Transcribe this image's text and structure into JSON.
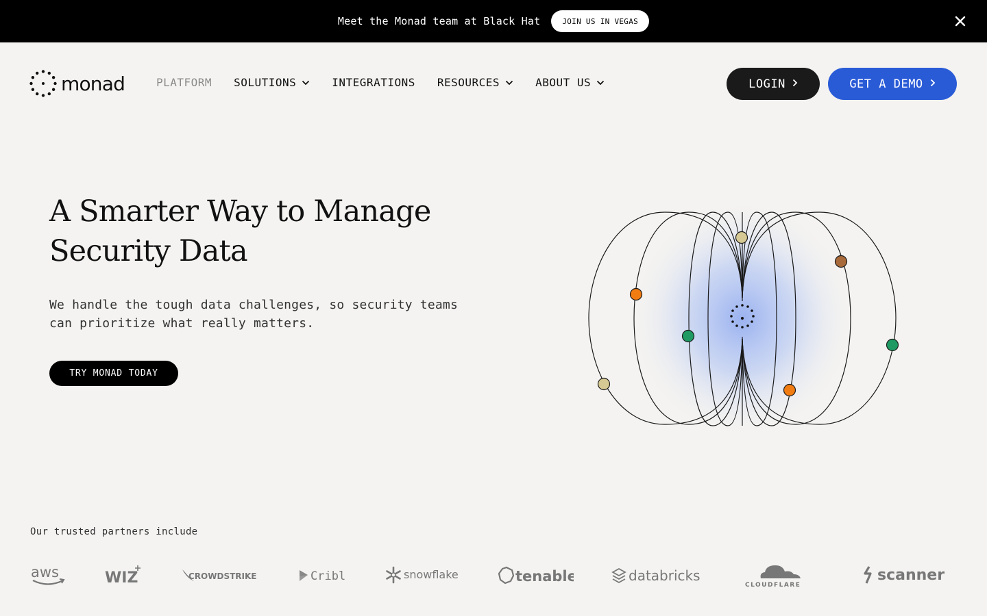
{
  "announcement": {
    "text": "Meet the Monad team at Black Hat",
    "button_label": "JOIN US IN VEGAS"
  },
  "brand": {
    "name": "monad"
  },
  "nav": {
    "items": [
      {
        "label": "PLATFORM",
        "has_dropdown": false
      },
      {
        "label": "SOLUTIONS",
        "has_dropdown": true
      },
      {
        "label": "INTEGRATIONS",
        "has_dropdown": false
      },
      {
        "label": "RESOURCES",
        "has_dropdown": true
      },
      {
        "label": "ABOUT US",
        "has_dropdown": true
      }
    ],
    "login_label": "LOGIN",
    "demo_label": "GET A DEMO"
  },
  "hero": {
    "title_line1": "A Smarter Way to Manage",
    "title_line2": "Security Data",
    "subtitle_line1": "We handle the tough data challenges, so security teams",
    "subtitle_line2": "can prioritize what really matters.",
    "cta_label": "TRY MONAD TODAY"
  },
  "partners": {
    "label": "Our trusted partners include",
    "logos": [
      {
        "name": "aws",
        "icon": "aws-logo"
      },
      {
        "name": "WIZ",
        "icon": "wiz-logo"
      },
      {
        "name": "CROWDSTRIKE",
        "icon": "crowdstrike-logo"
      },
      {
        "name": "Cribl",
        "icon": "cribl-logo"
      },
      {
        "name": "snowflake",
        "icon": "snowflake-logo"
      },
      {
        "name": "tenable",
        "icon": "tenable-logo"
      },
      {
        "name": "databricks",
        "icon": "databricks-logo"
      },
      {
        "name": "CLOUDFLARE",
        "icon": "cloudflare-logo"
      },
      {
        "name": "scanner",
        "icon": "scanner-logo"
      }
    ]
  },
  "colors": {
    "accent_blue": "#2a5bd7",
    "background": "#f4f3f1",
    "node_orange": "#f07c12",
    "node_green": "#1f9a63",
    "node_beige": "#d6c994",
    "node_brown": "#a86a3a"
  }
}
